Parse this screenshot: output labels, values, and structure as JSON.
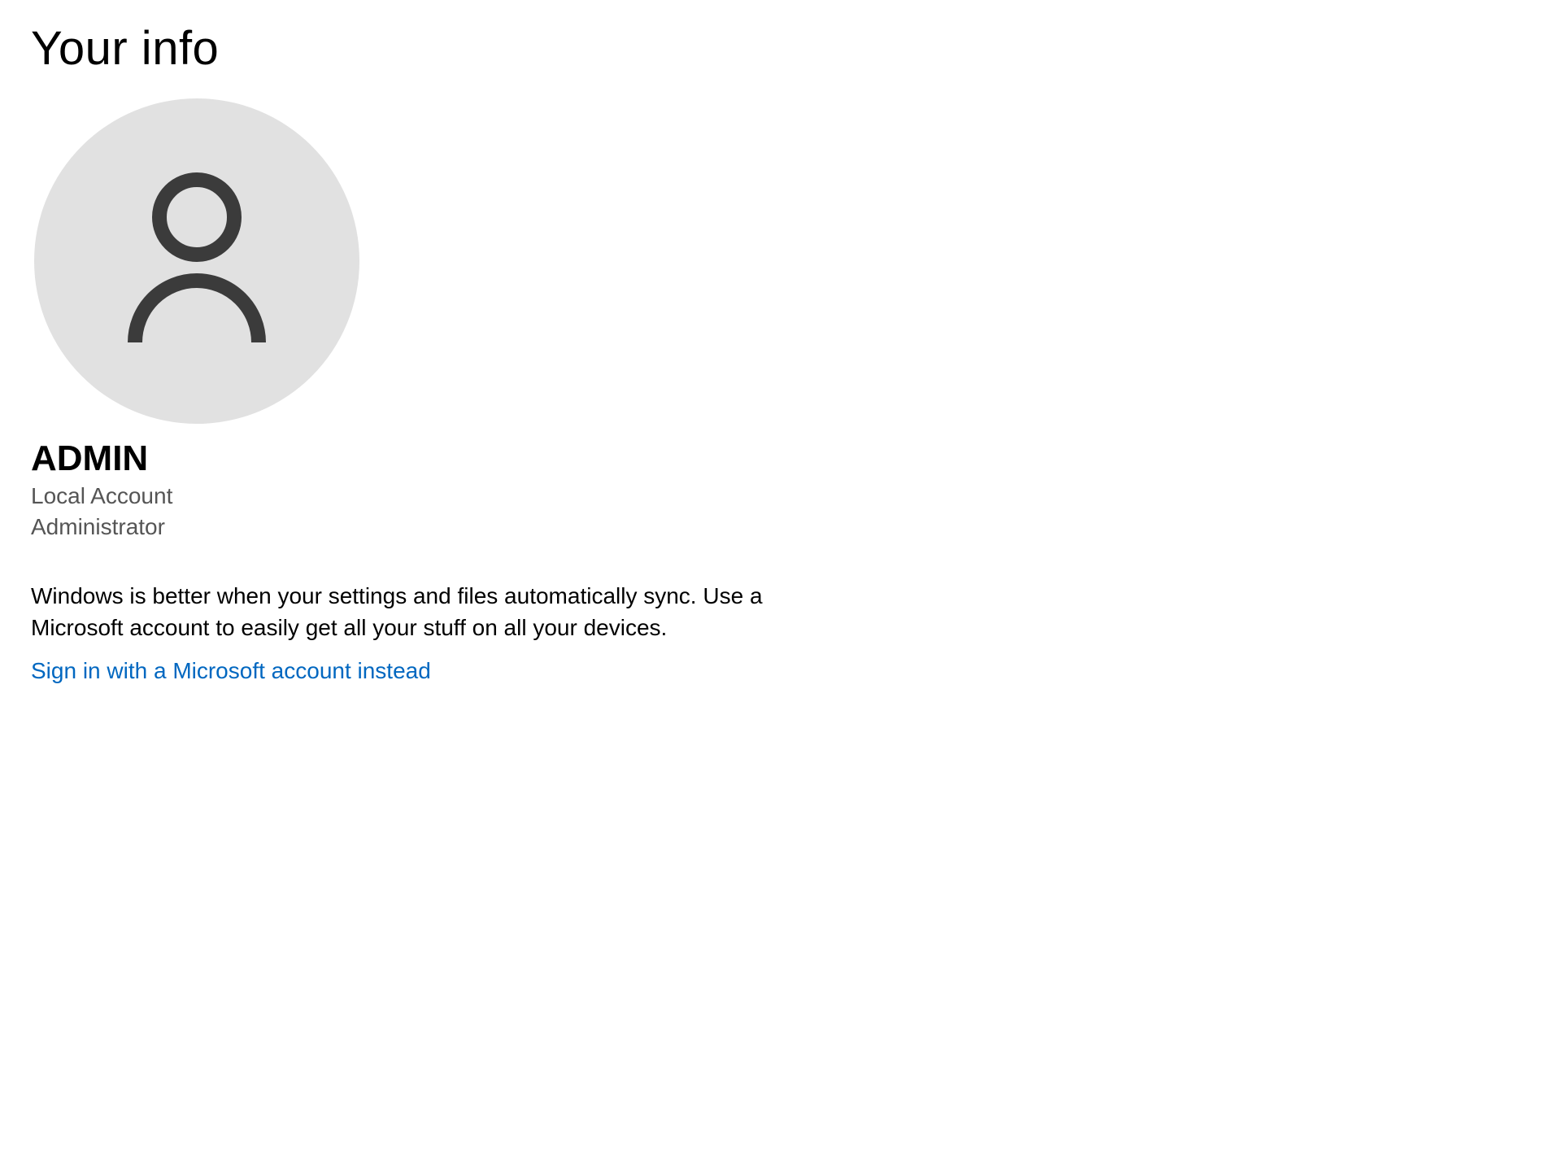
{
  "page_title": "Your info",
  "account": {
    "name": "ADMIN",
    "type": "Local Account",
    "role": "Administrator"
  },
  "description": "Windows is better when your settings and files automatically sync. Use a Microsoft account to easily get all your stuff on all your devices.",
  "signin_link": "Sign in with a Microsoft account instead"
}
